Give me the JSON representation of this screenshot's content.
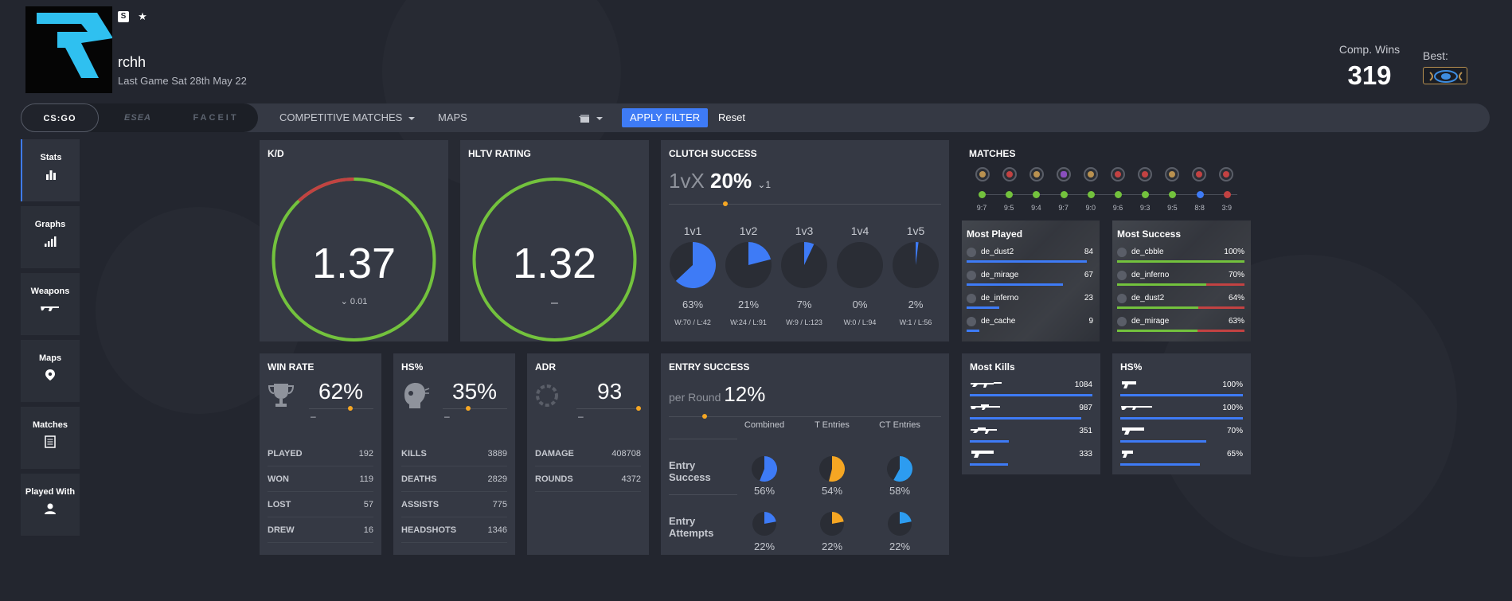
{
  "profile": {
    "username": "rchh",
    "last_game": "Last Game Sat 28th May 22",
    "comp_wins_label": "Comp. Wins",
    "comp_wins": "319",
    "best_label": "Best:"
  },
  "filters": {
    "sources": [
      "CS:GO",
      "ESEA",
      "FACEIT"
    ],
    "match_type": "COMPETITIVE MATCHES",
    "maps": "MAPS",
    "apply": "APPLY FILTER",
    "reset": "Reset"
  },
  "sidebar": {
    "items": [
      {
        "label": "Stats",
        "icon": "bar-chart-icon"
      },
      {
        "label": "Graphs",
        "icon": "signal-bars-icon"
      },
      {
        "label": "Weapons",
        "icon": "rifle-icon"
      },
      {
        "label": "Maps",
        "icon": "map-pin-icon"
      },
      {
        "label": "Matches",
        "icon": "list-icon"
      },
      {
        "label": "Played With",
        "icon": "user-icon"
      }
    ]
  },
  "kd": {
    "title": "K/D",
    "value": "1.37",
    "change": "0.01",
    "ratio": 0.88
  },
  "hltv": {
    "title": "HLTV RATING",
    "value": "1.32",
    "change": "–",
    "ratio": 1.0
  },
  "clutch": {
    "title": "CLUTCH SUCCESS",
    "prefix": "1vX",
    "value": "20%",
    "sub": "1",
    "items": [
      {
        "label": "1v1",
        "pct": "63%",
        "fraction": 0.63,
        "wl": "W:70 / L:42"
      },
      {
        "label": "1v2",
        "pct": "21%",
        "fraction": 0.21,
        "wl": "W:24 / L:91"
      },
      {
        "label": "1v3",
        "pct": "7%",
        "fraction": 0.07,
        "wl": "W:9 / L:123"
      },
      {
        "label": "1v4",
        "pct": "0%",
        "fraction": 0.0,
        "wl": "W:0 / L:94"
      },
      {
        "label": "1v5",
        "pct": "2%",
        "fraction": 0.02,
        "wl": "W:1 / L:56"
      }
    ]
  },
  "matches": {
    "title": "MATCHES",
    "results": [
      {
        "score": "9:7",
        "result": "win",
        "icon": "gold"
      },
      {
        "score": "9:5",
        "result": "win",
        "icon": "red"
      },
      {
        "score": "9:4",
        "result": "win",
        "icon": "gold"
      },
      {
        "score": "9:7",
        "result": "win",
        "icon": "purple"
      },
      {
        "score": "9:0",
        "result": "win",
        "icon": "gold"
      },
      {
        "score": "9:6",
        "result": "win",
        "icon": "red"
      },
      {
        "score": "9:3",
        "result": "win",
        "icon": "red"
      },
      {
        "score": "9:5",
        "result": "win",
        "icon": "gold"
      },
      {
        "score": "8:8",
        "result": "draw",
        "icon": "red"
      },
      {
        "score": "3:9",
        "result": "loss",
        "icon": "red"
      }
    ]
  },
  "most_played": {
    "title": "Most Played",
    "items": [
      {
        "map": "de_dust2",
        "value": "84",
        "fraction": 0.95
      },
      {
        "map": "de_mirage",
        "value": "67",
        "fraction": 0.76
      },
      {
        "map": "de_inferno",
        "value": "23",
        "fraction": 0.26
      },
      {
        "map": "de_cache",
        "value": "9",
        "fraction": 0.1
      }
    ]
  },
  "most_success": {
    "title": "Most Success",
    "items": [
      {
        "map": "de_cbble",
        "value": "100%",
        "fraction": 1.0
      },
      {
        "map": "de_inferno",
        "value": "70%",
        "fraction": 0.7
      },
      {
        "map": "de_dust2",
        "value": "64%",
        "fraction": 0.64
      },
      {
        "map": "de_mirage",
        "value": "63%",
        "fraction": 0.63
      }
    ]
  },
  "winrate": {
    "title": "WIN RATE",
    "value": "62%",
    "dash": "–",
    "rows": [
      {
        "k": "PLAYED",
        "v": "192"
      },
      {
        "k": "WON",
        "v": "119"
      },
      {
        "k": "LOST",
        "v": "57"
      },
      {
        "k": "DREW",
        "v": "16"
      }
    ]
  },
  "hs": {
    "title": "HS%",
    "value": "35%",
    "dash": "–",
    "rows": [
      {
        "k": "KILLS",
        "v": "3889"
      },
      {
        "k": "DEATHS",
        "v": "2829"
      },
      {
        "k": "ASSISTS",
        "v": "775"
      },
      {
        "k": "HEADSHOTS",
        "v": "1346"
      }
    ]
  },
  "adr": {
    "title": "ADR",
    "value": "93",
    "dash": "–",
    "rows": [
      {
        "k": "DAMAGE",
        "v": "408708"
      },
      {
        "k": "ROUNDS",
        "v": "4372"
      }
    ]
  },
  "entry": {
    "title": "ENTRY SUCCESS",
    "per_round_label": "per Round",
    "per_round": "12%",
    "cols": [
      "Combined",
      "T Entries",
      "CT Entries"
    ],
    "rows": [
      {
        "label": "Entry Success",
        "cells": [
          {
            "pct": "56%",
            "fraction": 0.56,
            "color": "#3e7bf6"
          },
          {
            "pct": "54%",
            "fraction": 0.54,
            "color": "#f5a623"
          },
          {
            "pct": "58%",
            "fraction": 0.58,
            "color": "#2d9cf0"
          }
        ]
      },
      {
        "label": "Entry Attempts",
        "cells": [
          {
            "pct": "22%",
            "fraction": 0.22,
            "color": "#3e7bf6"
          },
          {
            "pct": "22%",
            "fraction": 0.22,
            "color": "#f5a623"
          },
          {
            "pct": "22%",
            "fraction": 0.22,
            "color": "#2d9cf0"
          }
        ]
      }
    ]
  },
  "most_kills": {
    "title": "Most Kills",
    "items": [
      {
        "weapon": "ak47-icon",
        "value": "1084",
        "fraction": 1.0
      },
      {
        "weapon": "awp-icon",
        "value": "987",
        "fraction": 0.91
      },
      {
        "weapon": "m4a4-icon",
        "value": "351",
        "fraction": 0.32
      },
      {
        "weapon": "deagle-icon",
        "value": "333",
        "fraction": 0.31
      }
    ]
  },
  "hs_weapons": {
    "title": "HS%",
    "items": [
      {
        "weapon": "usp-icon",
        "value": "100%",
        "fraction": 1.0
      },
      {
        "weapon": "shotgun-icon",
        "value": "100%",
        "fraction": 1.0
      },
      {
        "weapon": "deagle-icon",
        "value": "70%",
        "fraction": 0.7
      },
      {
        "weapon": "glock-icon",
        "value": "65%",
        "fraction": 0.65
      }
    ]
  },
  "colors": {
    "accent": "#3e7bf6",
    "green": "#73c23d",
    "red": "#c24242",
    "orange": "#f5a623",
    "card": "#353944"
  }
}
